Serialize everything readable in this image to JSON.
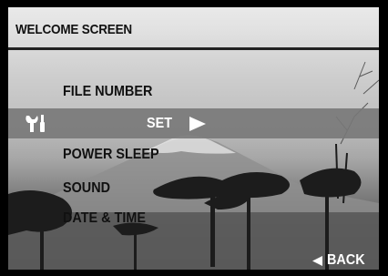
{
  "title": "WELCOME SCREEN",
  "menu": {
    "items": [
      {
        "label": "FILE NUMBER"
      },
      {
        "label": "SET",
        "icon": "wrench-screwdriver-icon",
        "selected": true
      },
      {
        "label": "POWER SLEEP"
      },
      {
        "label": "SOUND"
      },
      {
        "label": "DATE & TIME"
      }
    ]
  },
  "footer": {
    "back_label": "BACK",
    "back_icon": "left-triangle-icon"
  },
  "colors": {
    "text": "#111111",
    "selected_bg": "#787878",
    "selected_text": "#ffffff",
    "rule": "#222222"
  }
}
